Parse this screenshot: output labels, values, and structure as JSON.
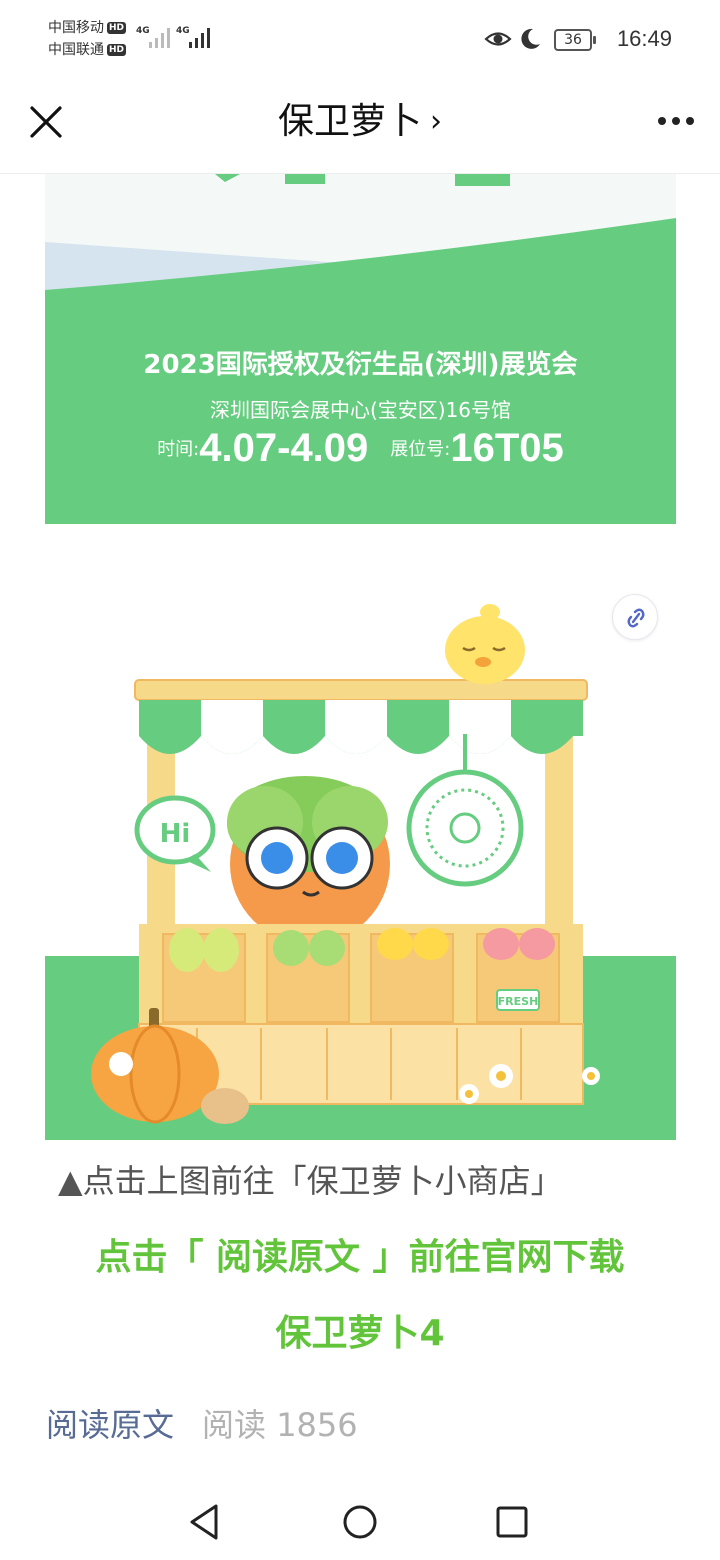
{
  "status_bar": {
    "carrier_1": "中国移动",
    "carrier_2": "中国联通",
    "hd_badge": "HD",
    "network": "4G",
    "battery": "36",
    "time": "16:49",
    "icons": [
      "eye-icon",
      "moon-icon",
      "battery-icon",
      "signal-icon"
    ]
  },
  "nav": {
    "title": "保卫萝卜",
    "title_chevron": "›",
    "icons": [
      "close-icon",
      "more-icon",
      "chevron-right-icon"
    ]
  },
  "banner": {
    "title": "2023国际授权及衍生品(深圳)展览会",
    "venue": "深圳国际会展中心(宝安区)16号馆",
    "time_label": "时间:",
    "time_value": "4.07-4.09",
    "booth_label": "展位号:",
    "booth_value": "16T05"
  },
  "illustration": {
    "greeting": "Hi",
    "fresh_tag": "FRESH",
    "icons": [
      "link-icon",
      "qr-code-icon",
      "chick-icon",
      "carrot-mascot-icon",
      "pumpkin-icon"
    ]
  },
  "caption": "▲点击上图前往「保卫萝卜小商店」",
  "cta": {
    "line1": "点击「 阅读原文 」前往官网下载",
    "line2": "保卫萝卜4"
  },
  "footer": {
    "read_original": "阅读原文",
    "read_count": "阅读 1856"
  },
  "colors": {
    "brand_green": "#66cc80",
    "cta_green": "#62c43a",
    "link_blue": "#576b95",
    "muted_gray": "#b2b2b2"
  }
}
